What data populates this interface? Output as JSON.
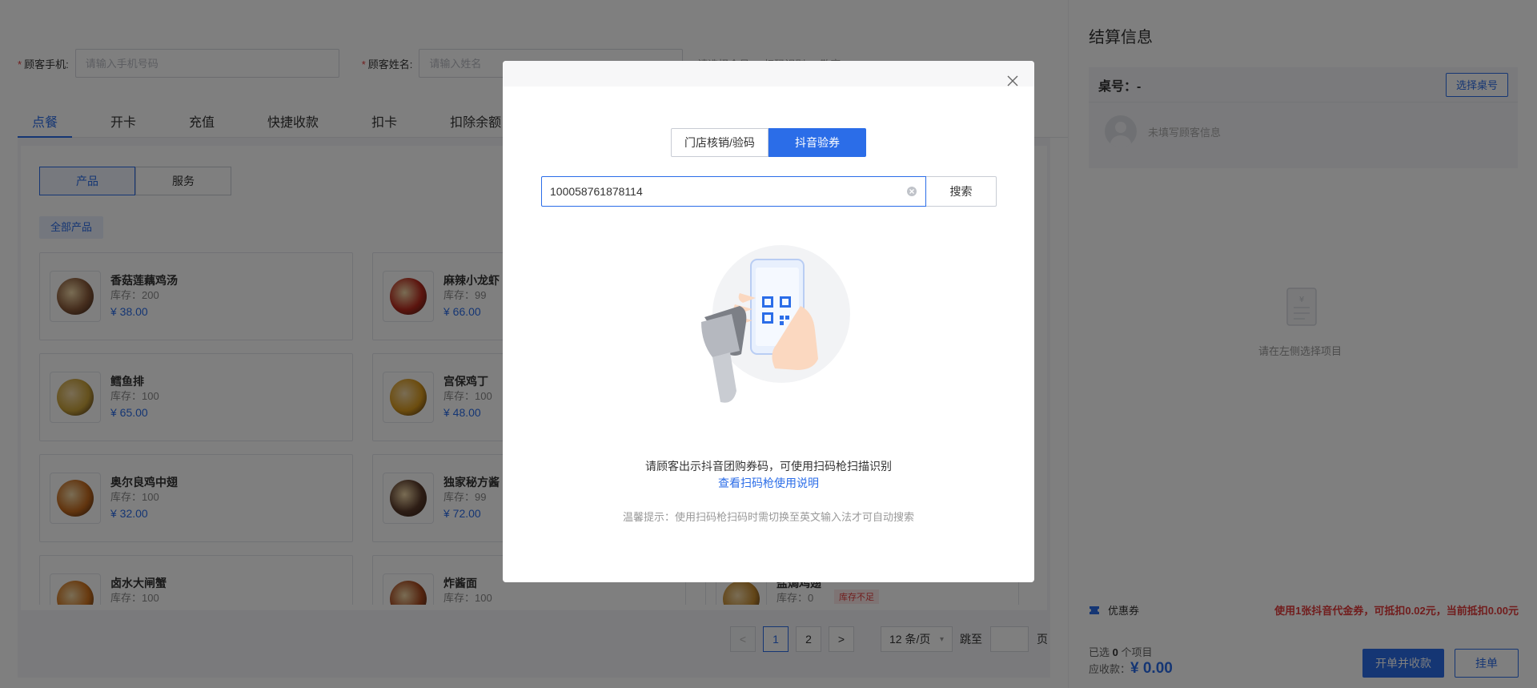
{
  "customer_form": {
    "phone_label": "顾客手机:",
    "phone_placeholder": "请输入手机号码",
    "name_label": "顾客姓名:",
    "name_placeholder": "请输入姓名",
    "extra_1": "请选择会员",
    "extra_2": "扫码识别",
    "extra_3": "散客"
  },
  "tabs": [
    "点餐",
    "开卡",
    "充值",
    "快捷收款",
    "扣卡",
    "扣除余额"
  ],
  "active_tab": 0,
  "segments": [
    "产品",
    "服务"
  ],
  "category_tag": "全部产品",
  "products": [
    {
      "name": "香菇莲藕鸡汤",
      "stock": "库存：200",
      "price": "¥ 38.00",
      "color": "#8a5a3a"
    },
    {
      "name": "麻辣小龙虾",
      "stock": "库存：99",
      "price": "¥ 66.00",
      "color": "#b82a1e"
    },
    {
      "name": "鳕鱼排",
      "stock": "库存：100",
      "price": "¥ 65.00",
      "color": "#c9a23a"
    },
    {
      "name": "宫保鸡丁",
      "stock": "库存：100",
      "price": "¥ 48.00",
      "color": "#d99a1e"
    },
    {
      "name": "奥尔良鸡中翅",
      "stock": "库存：100",
      "price": "¥ 32.00",
      "color": "#c46a1e"
    },
    {
      "name": "独家秘方酱",
      "stock": "库存：99",
      "price": "¥ 72.00",
      "color": "#5a3a2a"
    },
    {
      "name": "卤水大闸蟹",
      "stock": "库存：100",
      "price": "",
      "color": "#d0741e"
    },
    {
      "name": "炸酱面",
      "stock": "库存：100",
      "price": "",
      "color": "#a8481e"
    },
    {
      "name": "盐焗鸡翅",
      "stock": "库存：0",
      "price": "",
      "color": "#c48a2e",
      "warn": "库存不足"
    }
  ],
  "pagination": {
    "prev": "<",
    "pages": [
      "1",
      "2"
    ],
    "next": ">",
    "page_size": "12 条/页",
    "jump_label": "跳至",
    "page_suffix": "页"
  },
  "settlement": {
    "title": "结算信息",
    "table_label": "桌号：-",
    "choose_table": "选择桌号",
    "customer_hint": "未填写顾客信息",
    "empty_hint": "请在左侧选择项目",
    "coupon_label": "优惠券",
    "coupon_info": "使用1张抖音代金券，可抵扣0.02元，当前抵扣0.00元",
    "selected_prefix": "已选 ",
    "selected_count": "0",
    "selected_suffix": " 个项目",
    "receivable_label": "应收款：",
    "receivable_amount": "¥ 0.00",
    "checkout_button": "开单并收款",
    "hold_button": "挂单"
  },
  "modal": {
    "mode_tabs": [
      "门店核销/验码",
      "抖音验券"
    ],
    "active_mode": 1,
    "search_value": "100058761878114",
    "search_button": "搜索",
    "instruction": "请顾客出示抖音团购券码，可使用扫码枪扫描识别",
    "guide_link": "查看扫码枪使用说明",
    "tip": "温馨提示：使用扫码枪扫码时需切换至英文输入法才可自动搜索"
  },
  "colors": {
    "accent": "#2b6de8",
    "danger": "#e23b3b"
  }
}
